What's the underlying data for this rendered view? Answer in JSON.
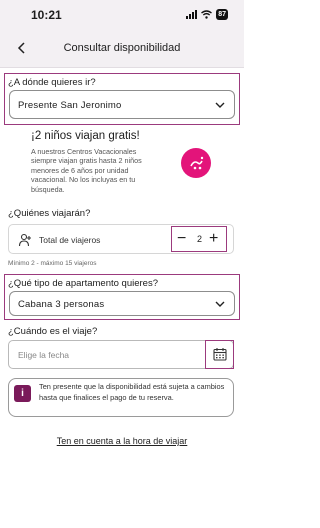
{
  "status_bar": {
    "time": "10:21",
    "battery": "87"
  },
  "header": {
    "title": "Consultar disponibilidad",
    "back_icon": "chevron-left-icon"
  },
  "destination": {
    "label": "¿A dónde quieres ir?",
    "value": "Presente San Jeronimo"
  },
  "promo": {
    "title": "¡2 niños viajan gratis!",
    "text": "A nuestros Centros Vacacionales siempre viajan gratis hasta 2 niños menores de 6 años por unidad vacacional. No los incluyas en tu búsqueda."
  },
  "travelers": {
    "label": "¿Quiénes viajarán?",
    "row_label": "Total de viajeros",
    "count": "2",
    "minus": "−",
    "plus": "+",
    "hint": "Mínimo 2 - máximo 15 viajeros"
  },
  "apartment": {
    "label": "¿Qué tipo de apartamento quieres?",
    "value": "Cabana 3 personas"
  },
  "date": {
    "label": "¿Cuándo es el viaje?",
    "placeholder": "Elige la fecha"
  },
  "notice": {
    "icon": "i",
    "text": "Ten presente que la disponibilidad está sujeta a cambios hasta que finalices el pago de tu reserva."
  },
  "footer_link": "Ten en cuenta a la hora de viajar",
  "colors": {
    "accent": "#9b3a7d",
    "badge": "#e3147a",
    "header_bg": "#f3f0f3"
  }
}
